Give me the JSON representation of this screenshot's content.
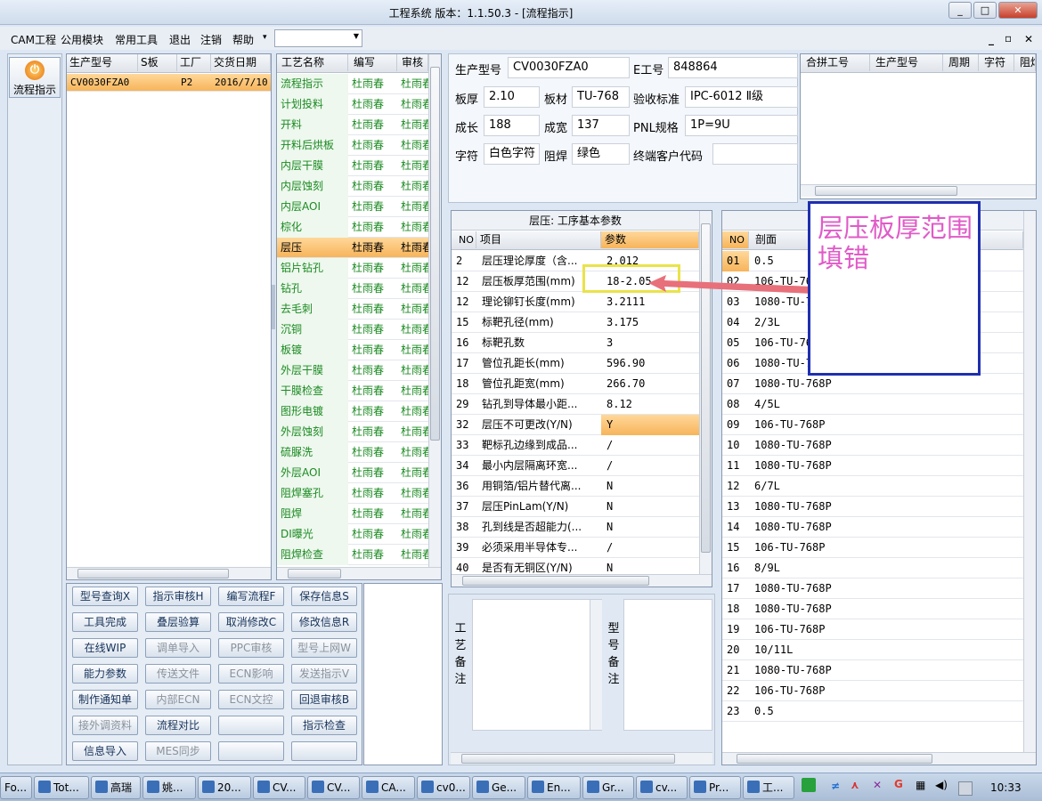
{
  "window": {
    "title": "工程系统  版本：1.1.50.3 - [流程指示]",
    "min": "_",
    "max": "□",
    "close": "✕"
  },
  "menu": [
    "CAM工程",
    "公用模块",
    "常用工具",
    "退出",
    "注销",
    "帮助"
  ],
  "menu_dropdown_value": "",
  "menu_right": [
    "_",
    "▫",
    "✕"
  ],
  "side_button": {
    "label": "流程指示",
    "icon": "flow-icon"
  },
  "order_grid": {
    "headers": [
      "生产型号",
      "S板",
      "工厂",
      "交货日期"
    ],
    "rows": [
      [
        "CV0030FZA0",
        "",
        "P2",
        "2016/7/10"
      ]
    ]
  },
  "process_grid": {
    "headers": [
      "工艺名称",
      "编写",
      "审核"
    ],
    "rows": [
      [
        "流程指示",
        "杜雨春",
        "杜雨春"
      ],
      [
        "计划投料",
        "杜雨春",
        "杜雨春"
      ],
      [
        "开料",
        "杜雨春",
        "杜雨春"
      ],
      [
        "开料后烘板",
        "杜雨春",
        "杜雨春"
      ],
      [
        "内层干膜",
        "杜雨春",
        "杜雨春"
      ],
      [
        "内层蚀刻",
        "杜雨春",
        "杜雨春"
      ],
      [
        "内层AOI",
        "杜雨春",
        "杜雨春"
      ],
      [
        "棕化",
        "杜雨春",
        "杜雨春"
      ],
      [
        "层压",
        "杜雨春",
        "杜雨春"
      ],
      [
        "铝片钻孔",
        "杜雨春",
        "杜雨春"
      ],
      [
        "钻孔",
        "杜雨春",
        "杜雨春"
      ],
      [
        "去毛刺",
        "杜雨春",
        "杜雨春"
      ],
      [
        "沉铜",
        "杜雨春",
        "杜雨春"
      ],
      [
        "板镀",
        "杜雨春",
        "杜雨春"
      ],
      [
        "外层干膜",
        "杜雨春",
        "杜雨春"
      ],
      [
        "干膜检查",
        "杜雨春",
        "杜雨春"
      ],
      [
        "图形电镀",
        "杜雨春",
        "杜雨春"
      ],
      [
        "外层蚀刻",
        "杜雨春",
        "杜雨春"
      ],
      [
        "硫脲洗",
        "杜雨春",
        "杜雨春"
      ],
      [
        "外层AOI",
        "杜雨春",
        "杜雨春"
      ],
      [
        "阻焊塞孔",
        "杜雨春",
        "杜雨春"
      ],
      [
        "阻焊",
        "杜雨春",
        "杜雨春"
      ],
      [
        "DI曝光",
        "杜雨春",
        "杜雨春"
      ],
      [
        "阻焊检查",
        "杜雨春",
        "杜雨春"
      ]
    ],
    "selected": 8
  },
  "actions": [
    [
      "型号查询X",
      "指示审核H",
      "编写流程F",
      "保存信息S"
    ],
    [
      "工具完成",
      "叠层验算",
      "取消修改C",
      "修改信息R"
    ],
    [
      "在线WIP",
      "调单导入",
      "PPC审核",
      "型号上网W"
    ],
    [
      "能力参数",
      "传送文件",
      "ECN影响",
      "发送指示V"
    ],
    [
      "制作通知单",
      "内部ECN",
      "ECN文控",
      "回退审核B"
    ],
    [
      "接外调资料",
      "流程对比",
      "",
      "指示检查"
    ],
    [
      "信息导入",
      "MES同步",
      "",
      ""
    ]
  ],
  "info": {
    "part_no_label": "生产型号",
    "part_no": "CV0030FZA0",
    "e_no_label": "E工号",
    "e_no": "848864",
    "thickness_label": "板厚",
    "thickness": "2.10",
    "material_label": "板材",
    "material": "TU-768",
    "standard_label": "验收标准",
    "standard": "IPC-6012 Ⅱ级",
    "length_label": "成长",
    "length": "188",
    "width_label": "成宽",
    "width": "137",
    "pnl_label": "PNL规格",
    "pnl": "1P=9U",
    "char_label": "字符",
    "char": "白色字符",
    "mask_label": "阻焊",
    "mask": "绿色",
    "customer_label": "终端客户代码",
    "customer": ""
  },
  "merge_grid": {
    "headers": [
      "合拼工号",
      "生产型号",
      "周期",
      "字符",
      "阻焊"
    ]
  },
  "param_grid": {
    "caption": "层压: 工序基本参数",
    "headers": [
      "NO",
      "项目",
      "参数"
    ],
    "rows": [
      [
        "2",
        "层压理论厚度（含...",
        "2.012"
      ],
      [
        "12",
        "层压板厚范围(mm)",
        "18-2.05"
      ],
      [
        "12",
        "理论铆钉长度(mm)",
        "3.2111"
      ],
      [
        "15",
        "标靶孔径(mm)",
        "3.175"
      ],
      [
        "16",
        "标靶孔数",
        "3"
      ],
      [
        "17",
        "管位孔距长(mm)",
        "596.90"
      ],
      [
        "18",
        "管位孔距宽(mm)",
        "266.70"
      ],
      [
        "29",
        "钻孔到导体最小距...",
        "8.12"
      ],
      [
        "32",
        "层压不可更改(Y/N)",
        "Y"
      ],
      [
        "33",
        "靶标孔边缘到成品...",
        "/"
      ],
      [
        "34",
        "最小内层隔离环宽...",
        "/"
      ],
      [
        "36",
        "用铜箔/铝片替代离...",
        "N"
      ],
      [
        "37",
        "层压PinLam(Y/N)",
        "N"
      ],
      [
        "38",
        "孔到线是否超能力(...",
        "N"
      ],
      [
        "39",
        "必须采用半导体专...",
        "/"
      ],
      [
        "40",
        "是否有无铜区(Y/N)",
        "N"
      ]
    ],
    "highlight_row": 8
  },
  "stack_grid": {
    "headers": [
      "NO",
      "剖面"
    ],
    "rows": [
      [
        "01",
        "0.5"
      ],
      [
        "02",
        "106-TU-768P"
      ],
      [
        "03",
        "1080-TU-768P"
      ],
      [
        "04",
        "2/3L"
      ],
      [
        "05",
        "106-TU-768P"
      ],
      [
        "06",
        "1080-TU-768P"
      ],
      [
        "07",
        "1080-TU-768P"
      ],
      [
        "08",
        "4/5L"
      ],
      [
        "09",
        "106-TU-768P"
      ],
      [
        "10",
        "1080-TU-768P"
      ],
      [
        "11",
        "1080-TU-768P"
      ],
      [
        "12",
        "6/7L"
      ],
      [
        "13",
        "1080-TU-768P"
      ],
      [
        "14",
        "1080-TU-768P"
      ],
      [
        "15",
        "106-TU-768P"
      ],
      [
        "16",
        "8/9L"
      ],
      [
        "17",
        "1080-TU-768P"
      ],
      [
        "18",
        "1080-TU-768P"
      ],
      [
        "19",
        "106-TU-768P"
      ],
      [
        "20",
        "10/11L"
      ],
      [
        "21",
        "1080-TU-768P"
      ],
      [
        "22",
        "106-TU-768P"
      ],
      [
        "23",
        "0.5"
      ]
    ]
  },
  "remarks": {
    "process_label": "工艺备注",
    "model_label": "型号备注"
  },
  "annotation": {
    "text": "层压板厚范围填错"
  },
  "taskbar": {
    "items": [
      "Fo...",
      "Tot...",
      "高瑞",
      "姚...",
      "20...",
      "CV...",
      "CV...",
      "CA...",
      "cv0...",
      "Ge...",
      "En...",
      "Gr...",
      "cv...",
      "Pr...",
      "工..."
    ],
    "clock": "10:33"
  },
  "colors": {
    "selected_row": "#f7b45a",
    "green_text": "#1b8a22",
    "annotation": "#e05bc8",
    "annotation_border": "#1f2fb0",
    "arrow": "#e8707a",
    "highlight_box": "#e9e34a"
  }
}
